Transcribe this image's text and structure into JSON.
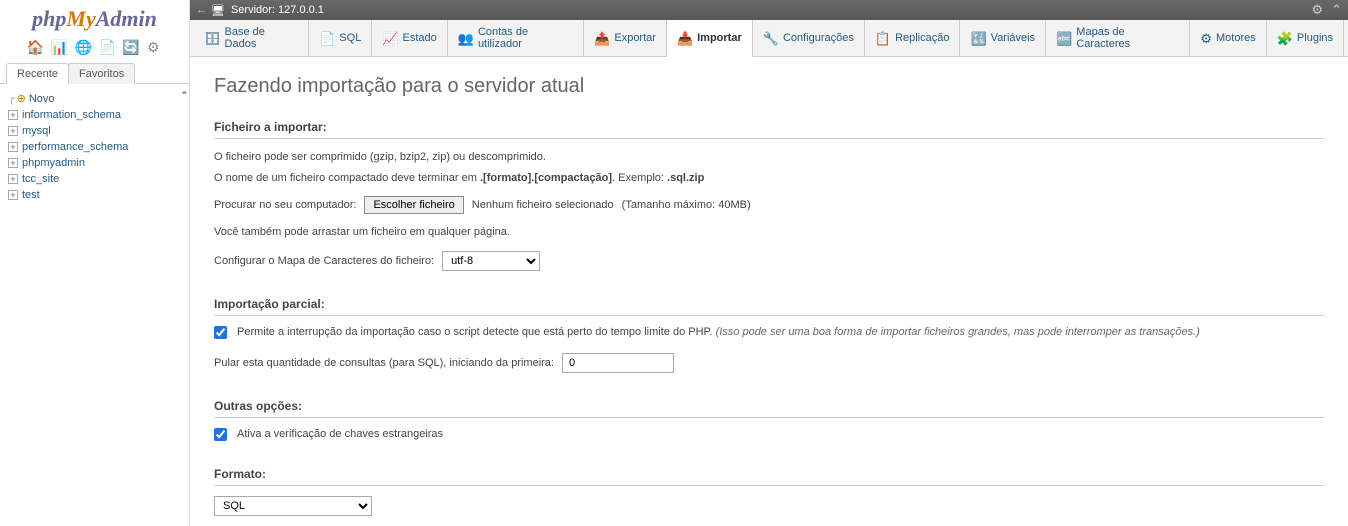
{
  "logo": {
    "php": "php",
    "my": "My",
    "admin": "Admin"
  },
  "sidebar": {
    "tabs": {
      "recent": "Recente",
      "favorites": "Favoritos"
    },
    "new_label": "Novo",
    "items": [
      {
        "label": "information_schema"
      },
      {
        "label": "mysql"
      },
      {
        "label": "performance_schema"
      },
      {
        "label": "phpmyadmin"
      },
      {
        "label": "tcc_site"
      },
      {
        "label": "test"
      }
    ]
  },
  "topbar": {
    "server_label": "Servidor: 127.0.0.1"
  },
  "menu": {
    "databases": "Base de Dados",
    "sql": "SQL",
    "status": "Estado",
    "users": "Contas de utilizador",
    "export": "Exportar",
    "import": "Importar",
    "settings": "Configurações",
    "replication": "Replicação",
    "variables": "Variáveis",
    "charsets": "Mapas de Caracteres",
    "engines": "Motores",
    "plugins": "Plugins"
  },
  "content": {
    "title": "Fazendo importação para o servidor atual",
    "file_section": {
      "heading": "Ficheiro a importar:",
      "line1": "O ficheiro pode ser comprimido (gzip, bzip2, zip) ou descomprimido.",
      "line2a": "O nome de um ficheiro compactado deve terminar em ",
      "line2b": ".[formato].[compactação]",
      "line2c": ". Exemplo: ",
      "line2d": ".sql.zip",
      "browse_label": "Procurar no seu computador:",
      "browse_button": "Escolher ficheiro",
      "no_file": "Nenhum ficheiro selecionado",
      "max_size": "(Tamanho máximo: 40MB)",
      "drag_hint": "Você também pode arrastar um ficheiro em qualquer página.",
      "charset_label": "Configurar o Mapa de Caracteres do ficheiro:",
      "charset_value": "utf-8"
    },
    "partial_section": {
      "heading": "Importação parcial:",
      "checkbox_text": "Permite a interrupção da importação caso o script detecte que está perto do tempo limite do PHP. ",
      "checkbox_note": "(Isso pode ser uma boa forma de importar ficheiros grandes, mas pode interromper as transações.)",
      "skip_label": "Pular esta quantidade de consultas (para SQL), iniciando da primeira:",
      "skip_value": "0"
    },
    "other_section": {
      "heading": "Outras opções:",
      "fk_check": "Ativa a verificação de chaves estrangeiras"
    },
    "format_section": {
      "heading": "Formato:",
      "value": "SQL"
    }
  }
}
